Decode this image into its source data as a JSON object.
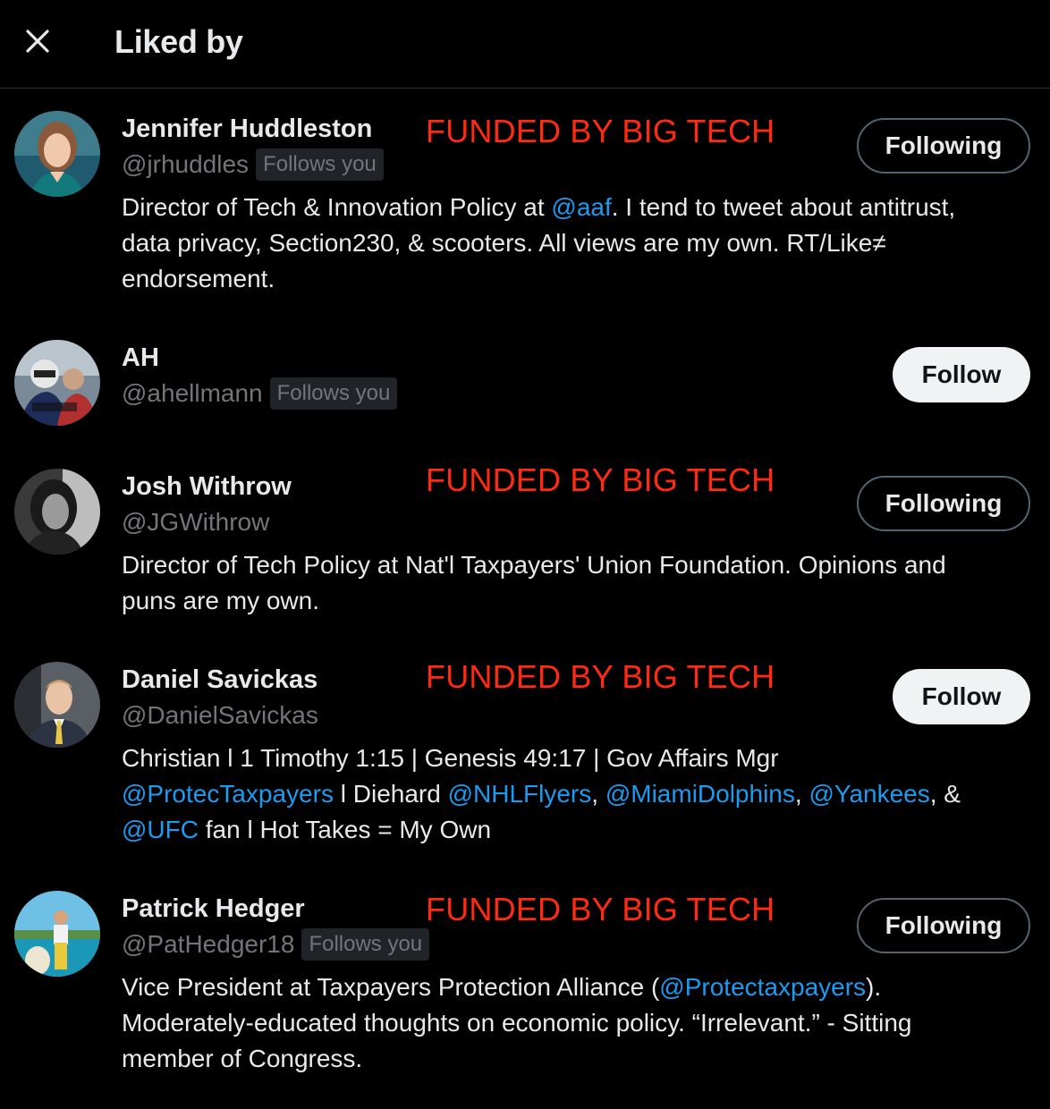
{
  "header": {
    "title": "Liked by"
  },
  "annotation": "FUNDED BY BIG TECH",
  "colors": {
    "background": "#000000",
    "text": "#e7e9ea",
    "muted": "#71767b",
    "link": "#1d9bf0",
    "annotation": "#ff2a12"
  },
  "users": [
    {
      "name": "Jennifer Huddleston",
      "handle": "@jrhuddles",
      "follows_you": "Follows you",
      "button": "Following",
      "bio": {
        "line1_a": "Director of Tech & Innovation Policy at ",
        "line1_mention": "@aaf",
        "line1_b": ". I tend to tweet about antitrust,",
        "line2": "data privacy, Section230, & scooters. All views are my own. RT/Like≠",
        "line3": "endorsement."
      }
    },
    {
      "name": "AH",
      "handle": "@ahellmann",
      "follows_you": "Follows you",
      "button": "Follow"
    },
    {
      "name": "Josh Withrow",
      "handle": "@JGWithrow",
      "button": "Following",
      "bio": {
        "line1": "Director of Tech Policy at Nat'l Taxpayers' Union Foundation. Opinions and",
        "line2": "puns are my own."
      }
    },
    {
      "name": "Daniel Savickas",
      "handle": "@DanielSavickas",
      "button": "Follow",
      "bio": {
        "line1": "Christian l 1 Timothy 1:15 | Genesis 49:17 | Gov Affairs Mgr",
        "m1": "@ProtecTaxpayers",
        "t1": " l Diehard ",
        "m2": "@NHLFlyers",
        "t2": ", ",
        "m3": "@MiamiDolphins",
        "t3": ", ",
        "m4": "@Yankees",
        "t4": ", &",
        "m5": "@UFC",
        "t5": " fan l Hot Takes = My Own"
      }
    },
    {
      "name": "Patrick Hedger",
      "handle": "@PatHedger18",
      "follows_you": "Follows you",
      "button": "Following",
      "bio": {
        "line1_a": "Vice President at Taxpayers Protection Alliance (",
        "line1_mention": "@Protectaxpayers",
        "line1_b": ").",
        "line2": "Moderately-educated thoughts on economic policy. “Irrelevant.” - Sitting",
        "line3": "member of Congress."
      }
    }
  ]
}
